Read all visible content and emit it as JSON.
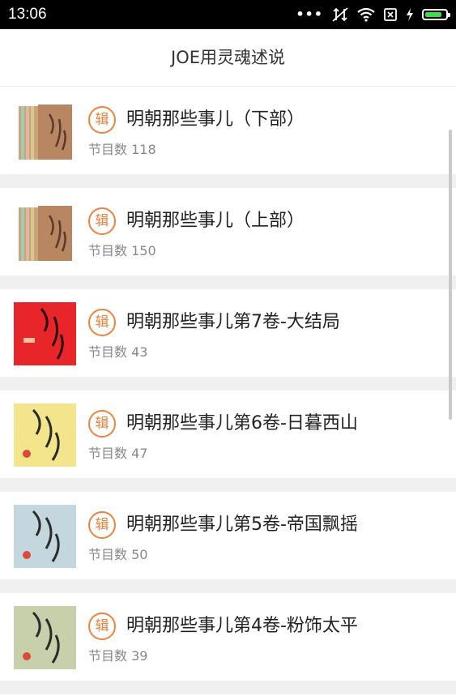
{
  "status_bar": {
    "time": "13:06",
    "icons": [
      "more-dots-icon",
      "data-off-icon",
      "wifi-icon",
      "sim-icon",
      "charging-icon",
      "battery-icon"
    ],
    "battery_color": "#3fdc4c",
    "battery_level": 0.85
  },
  "header": {
    "title": "JOE用灵魂述说"
  },
  "accent_color": "#f0823c",
  "badge_label": "辑",
  "count_prefix": "节目数",
  "albums": [
    {
      "title": "明朝那些事儿（下部）",
      "count": "118",
      "cover": "box-set"
    },
    {
      "title": "明朝那些事儿（上部）",
      "count": "150",
      "cover": "box-set"
    },
    {
      "title": "明朝那些事儿第7卷-大结局",
      "count": "43",
      "cover": "red"
    },
    {
      "title": "明朝那些事儿第6卷-日暮西山",
      "count": "47",
      "cover": "yellow"
    },
    {
      "title": "明朝那些事儿第5卷-帝国飘摇",
      "count": "50",
      "cover": "blue-grey"
    },
    {
      "title": "明朝那些事儿第4卷-粉饰太平",
      "count": "39",
      "cover": "sage"
    }
  ]
}
